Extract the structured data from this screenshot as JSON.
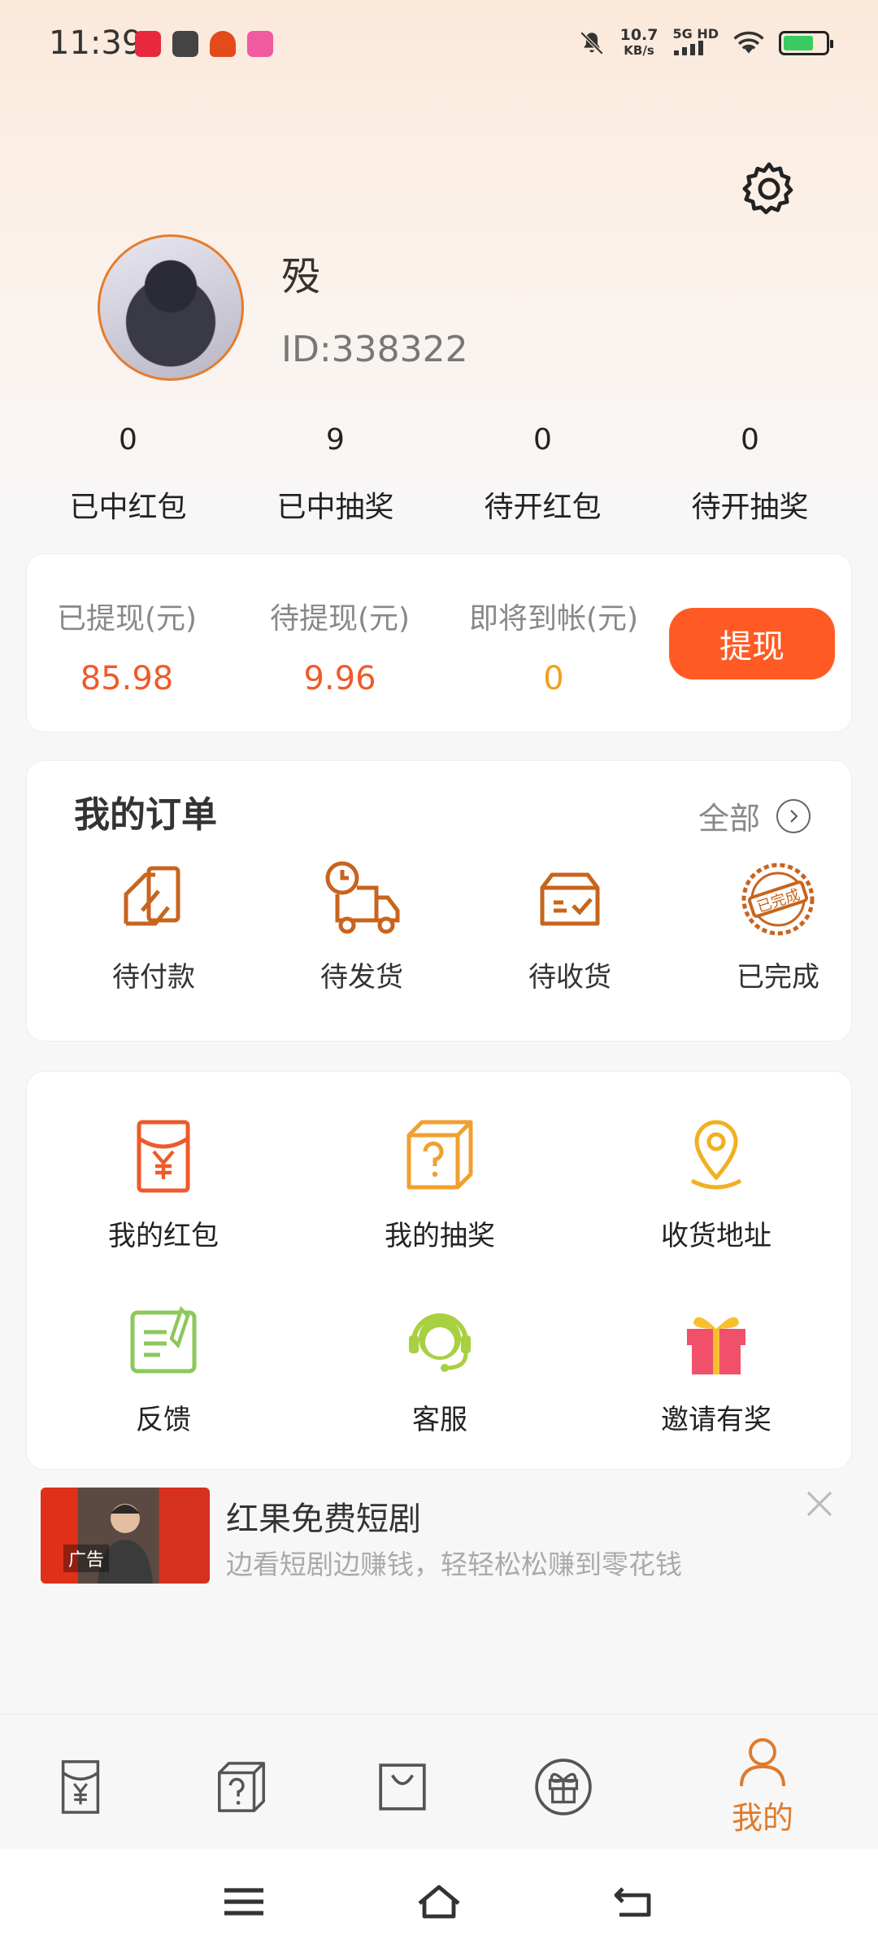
{
  "status_bar": {
    "time": "11:39",
    "speed_value": "10.7",
    "speed_unit": "KB/s",
    "network": "5G HD",
    "icons": [
      "notification-app-icon",
      "message-icon",
      "app-icon",
      "app-icon",
      "mute-bell-icon",
      "signal-icon",
      "wifi-icon",
      "battery-icon"
    ]
  },
  "profile": {
    "name": "殁",
    "id": "ID:338322"
  },
  "stats": [
    {
      "value": "0",
      "label": "已中红包"
    },
    {
      "value": "9",
      "label": "已中抽奖"
    },
    {
      "value": "0",
      "label": "待开红包"
    },
    {
      "value": "0",
      "label": "待开抽奖"
    }
  ],
  "wallet": {
    "withdrawn_label": "已提现(元)",
    "withdrawn_value": "85.98",
    "pending_label": "待提现(元)",
    "pending_value": "9.96",
    "arriving_label": "即将到帐(元)",
    "arriving_value": "0",
    "withdraw_button": "提现"
  },
  "orders": {
    "title": "我的订单",
    "all_label": "全部",
    "items": [
      {
        "label": "待付款",
        "icon": "card-payment-icon"
      },
      {
        "label": "待发货",
        "icon": "delivery-truck-icon"
      },
      {
        "label": "待收货",
        "icon": "package-box-icon"
      },
      {
        "label": "已完成",
        "icon": "completed-stamp-icon"
      }
    ],
    "stamp_text": "已完成"
  },
  "services": [
    {
      "label": "我的红包",
      "icon": "red-envelope-icon"
    },
    {
      "label": "我的抽奖",
      "icon": "mystery-box-icon"
    },
    {
      "label": "收货地址",
      "icon": "location-pin-icon"
    },
    {
      "label": "反馈",
      "icon": "feedback-icon"
    },
    {
      "label": "客服",
      "icon": "customer-service-icon"
    },
    {
      "label": "邀请有奖",
      "icon": "gift-icon"
    }
  ],
  "ad": {
    "badge": "广告",
    "title": "红果免费短剧",
    "description": "边看短剧边赚钱，轻轻松松赚到零花钱"
  },
  "tabbar": {
    "mine_label": "我的",
    "active_color": "#e07a2a"
  },
  "colors": {
    "accent": "#ff5a23",
    "value_red": "#f05a2a",
    "value_orange": "#f0a020",
    "icon_orange": "#c8641e"
  }
}
